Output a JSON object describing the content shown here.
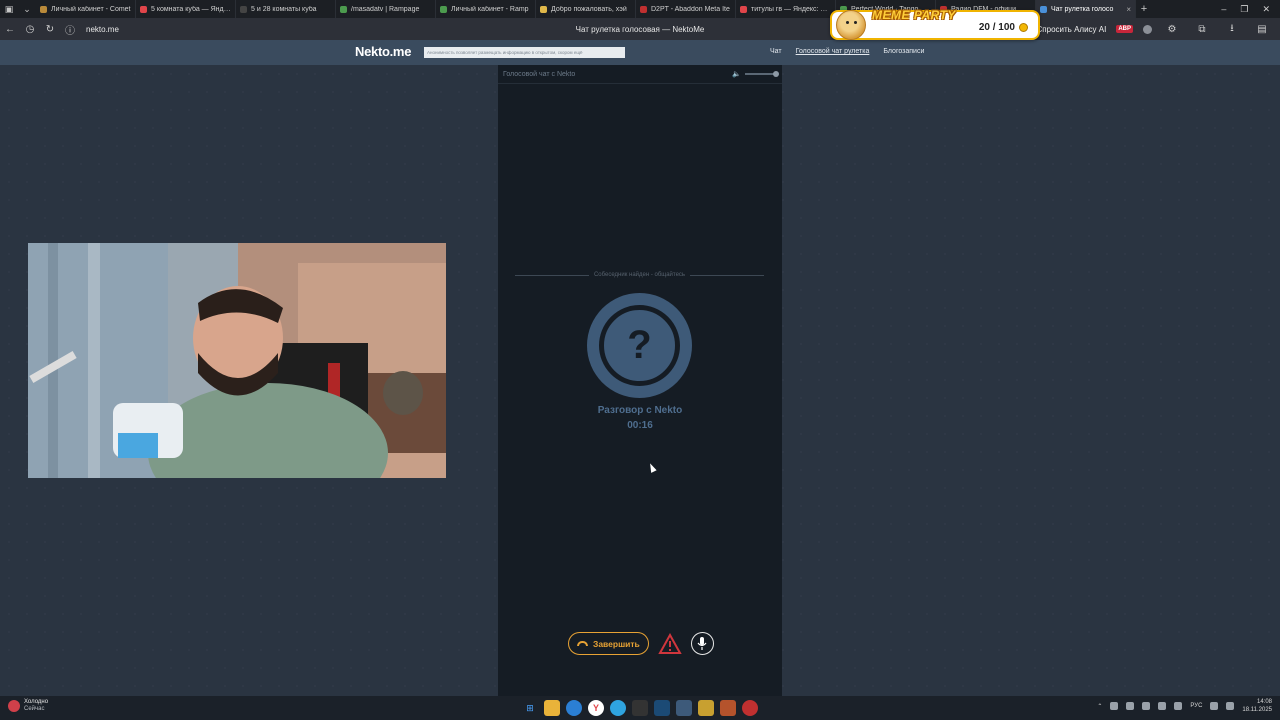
{
  "browser": {
    "tabs": [
      {
        "label": "Личный кабинет - Comet",
        "color": "#b98a3a"
      },
      {
        "label": "5 комната куба — Яндекс",
        "color": "#e0454a"
      },
      {
        "label": "5 и 28 комнаты куба",
        "color": "#444444"
      },
      {
        "label": "/masadatv | Rampage",
        "color": "#4c9b4e"
      },
      {
        "label": "Личный кабинет - Ramp",
        "color": "#4c9b4e"
      },
      {
        "label": "Добро пожаловать, хэй",
        "color": "#e0b84a"
      },
      {
        "label": "D2PT - Abaddon Meta Ite",
        "color": "#c03030"
      },
      {
        "label": "титулы гв — Яндекс: нам",
        "color": "#e0454a"
      },
      {
        "label": "Perfect World · Tango",
        "color": "#4c9b4e"
      },
      {
        "label": "Радио DFM - офици",
        "color": "#c03030"
      },
      {
        "label": "Чат рулетка голосо",
        "color": "#4a90d9",
        "active": true
      }
    ],
    "url": "nekto.me",
    "page_title": "Чат рулетка голосовая — NektoMe",
    "alice_label": "Спросить Алису AI",
    "abp_label": "ABP"
  },
  "meme_party": {
    "title": "MEME PARTY",
    "score": "20 / 100"
  },
  "site": {
    "logo": "Nekto.me",
    "anon_notice": "Анонимность позволяет размещать информацию в открытом, скором ещё",
    "nav": [
      "Чат",
      "Голосовой чат рулетка",
      "Блогозаписи"
    ]
  },
  "chat": {
    "panel_title": "Голосовой чат с Nekto",
    "status": "Собеседник найден - общайтесь",
    "avatar_symbol": "?",
    "partner": "Разговор с Nekto",
    "timer": "00:16",
    "end_button": "Завершить"
  },
  "taskbar": {
    "weather_title": "Холодно",
    "weather_sub": "Сейчас",
    "lang": "РУС",
    "time": "14:08",
    "date": "18.11.2025"
  }
}
